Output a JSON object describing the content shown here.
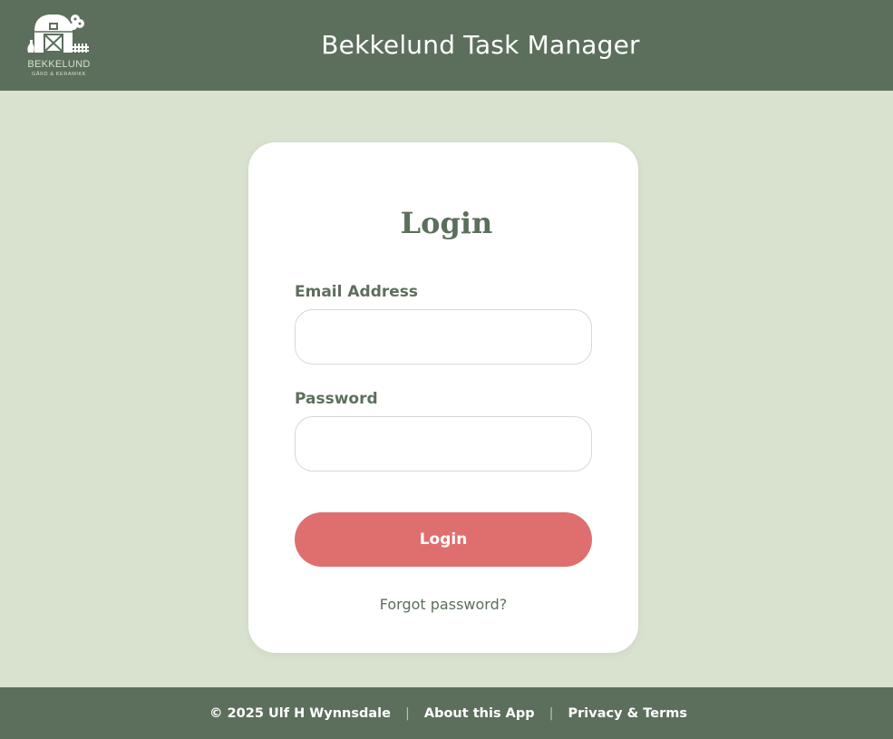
{
  "header": {
    "title": "Bekkelund Task Manager",
    "logo": {
      "name": "BEKKELUND",
      "subtitle": "GÅRD & KERAMIKK",
      "icon": "barn-icon"
    }
  },
  "login": {
    "title": "Login",
    "email_label": "Email Address",
    "email_value": "",
    "password_label": "Password",
    "password_value": "",
    "submit_label": "Login",
    "forgot_label": "Forgot password?"
  },
  "footer": {
    "copyright": "© 2025 Ulf H Wynnsdale",
    "separator": "|",
    "about_label": "About this App",
    "privacy_label": "Privacy & Terms"
  },
  "colors": {
    "header_bg": "#5c6f5c",
    "page_bg": "#d8e2cf",
    "card_bg": "#ffffff",
    "accent_button": "#df6f6f",
    "label_text": "#5c6f5c"
  }
}
